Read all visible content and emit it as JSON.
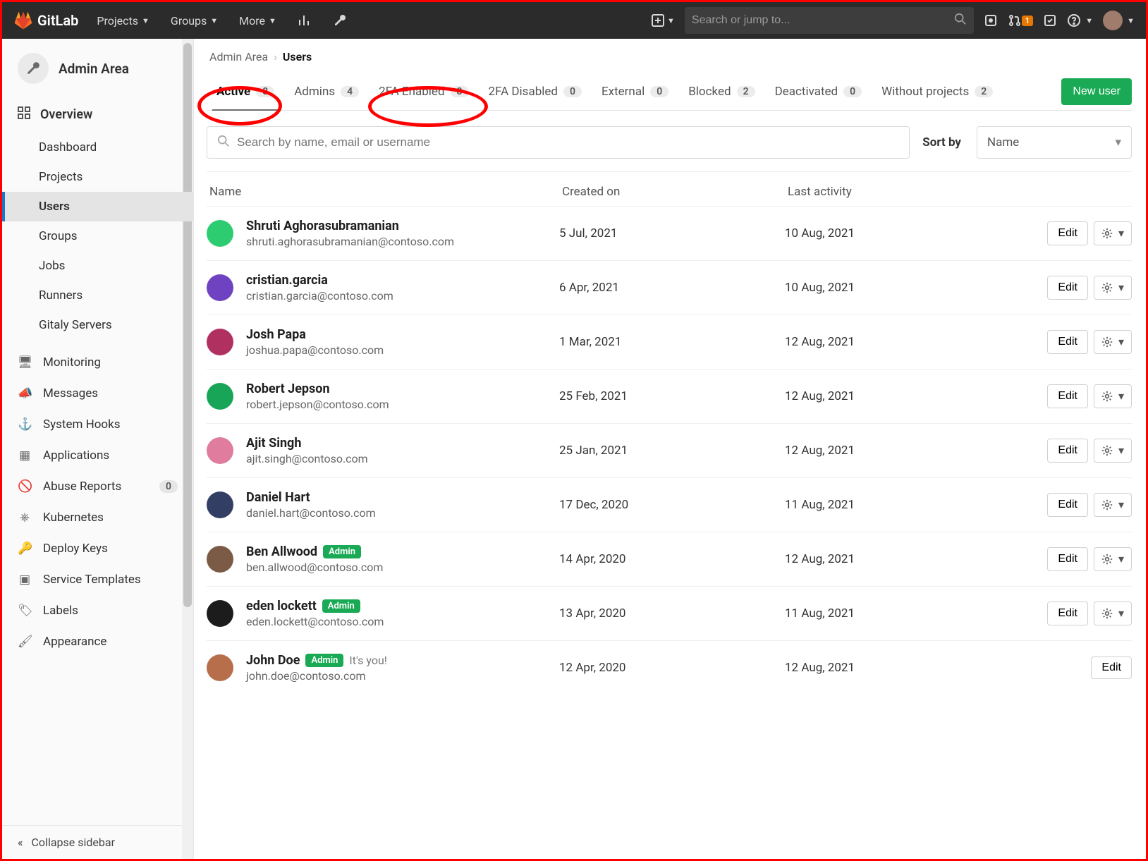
{
  "brand": "GitLab",
  "topnav": {
    "projects": "Projects",
    "groups": "Groups",
    "more": "More"
  },
  "search": {
    "placeholder": "Search or jump to..."
  },
  "mr_badge": "1",
  "breadcrumb": {
    "root": "Admin Area",
    "current": "Users"
  },
  "sidebar": {
    "title": "Admin Area",
    "overview": "Overview",
    "items": {
      "dashboard": "Dashboard",
      "projects": "Projects",
      "users": "Users",
      "groups": "Groups",
      "jobs": "Jobs",
      "runners": "Runners",
      "gitaly": "Gitaly Servers"
    },
    "rows": {
      "monitoring": "Monitoring",
      "messages": "Messages",
      "system_hooks": "System Hooks",
      "applications": "Applications",
      "abuse_reports": "Abuse Reports",
      "abuse_count": "0",
      "kubernetes": "Kubernetes",
      "deploy_keys": "Deploy Keys",
      "service_templates": "Service Templates",
      "labels": "Labels",
      "appearance": "Appearance"
    },
    "collapse": "Collapse sidebar"
  },
  "tabs": {
    "active": {
      "label": "Active",
      "count": "8"
    },
    "admins": {
      "label": "Admins",
      "count": "4"
    },
    "tfa_on": {
      "label": "2FA Enabled",
      "count": "8"
    },
    "tfa_off": {
      "label": "2FA Disabled",
      "count": "0"
    },
    "external": {
      "label": "External",
      "count": "0"
    },
    "blocked": {
      "label": "Blocked",
      "count": "2"
    },
    "deact": {
      "label": "Deactivated",
      "count": "0"
    },
    "noproj": {
      "label": "Without projects",
      "count": "2"
    }
  },
  "new_user": "New user",
  "filter": {
    "placeholder": "Search by name, email or username",
    "sort_by": "Sort by",
    "sort_value": "Name"
  },
  "head": {
    "name": "Name",
    "created": "Created on",
    "activity": "Last activity"
  },
  "edit_label": "Edit",
  "admin_chip": "Admin",
  "you_label": "It's you!",
  "users": [
    {
      "name": "Shruti Aghorasubramanian",
      "email": "shruti.aghorasubramanian@contoso.com",
      "created": "5 Jul, 2021",
      "activity": "10 Aug, 2021",
      "admin": false,
      "you": false,
      "c": "c1"
    },
    {
      "name": "cristian.garcia",
      "email": "cristian.garcia@contoso.com",
      "created": "6 Apr, 2021",
      "activity": "10 Aug, 2021",
      "admin": false,
      "you": false,
      "c": "c2"
    },
    {
      "name": "Josh Papa",
      "email": "joshua.papa@contoso.com",
      "created": "1 Mar, 2021",
      "activity": "12 Aug, 2021",
      "admin": false,
      "you": false,
      "c": "c3"
    },
    {
      "name": "Robert Jepson",
      "email": "robert.jepson@contoso.com",
      "created": "25 Feb, 2021",
      "activity": "12 Aug, 2021",
      "admin": false,
      "you": false,
      "c": "c4"
    },
    {
      "name": "Ajit Singh",
      "email": "ajit.singh@contoso.com",
      "created": "25 Jan, 2021",
      "activity": "12 Aug, 2021",
      "admin": false,
      "you": false,
      "c": "c5"
    },
    {
      "name": "Daniel Hart",
      "email": "daniel.hart@contoso.com",
      "created": "17 Dec, 2020",
      "activity": "11 Aug, 2021",
      "admin": false,
      "you": false,
      "c": "c6"
    },
    {
      "name": "Ben Allwood",
      "email": "ben.allwood@contoso.com",
      "created": "14 Apr, 2020",
      "activity": "12 Aug, 2021",
      "admin": true,
      "you": false,
      "c": "c7"
    },
    {
      "name": "eden lockett",
      "email": "eden.lockett@contoso.com",
      "created": "13 Apr, 2020",
      "activity": "11 Aug, 2021",
      "admin": true,
      "you": false,
      "c": "c8"
    },
    {
      "name": "John Doe",
      "email": "john.doe@contoso.com",
      "created": "12 Apr, 2020",
      "activity": "12 Aug, 2021",
      "admin": true,
      "you": true,
      "c": "c9"
    }
  ]
}
